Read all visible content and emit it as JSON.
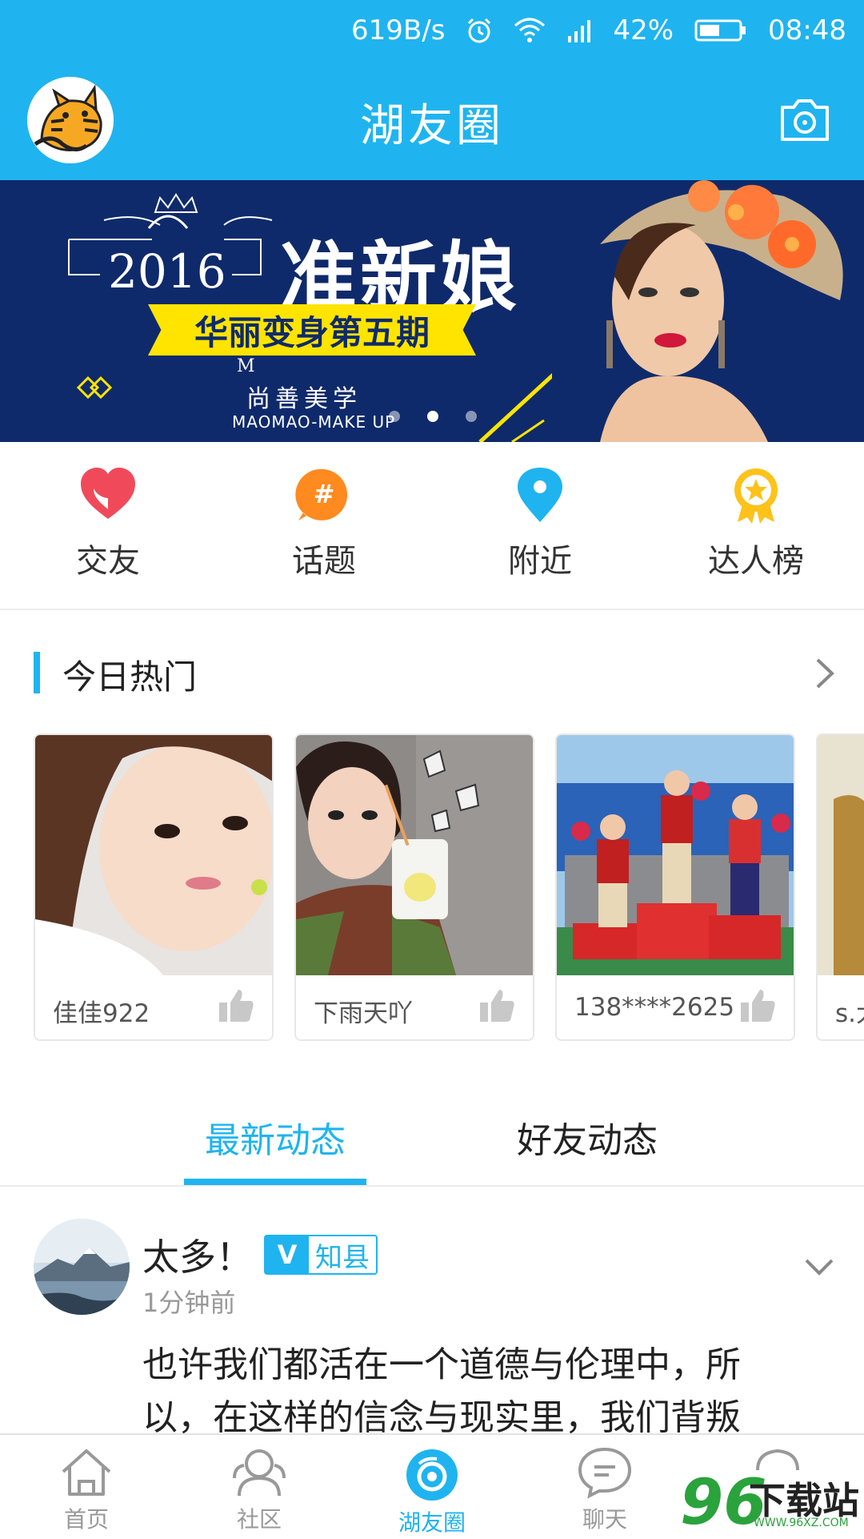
{
  "status_bar": {
    "speed": "619B/s",
    "battery": "42%",
    "time": "08:48",
    "icons": [
      "alarm-icon",
      "wifi-icon",
      "signal-icon",
      "battery-icon"
    ]
  },
  "header": {
    "title": "湖友圈",
    "camera_icon": "camera-icon",
    "accent": "#1fb4ef"
  },
  "banner": {
    "year": "2016",
    "title": "准新娘",
    "ribbon": "华丽变身第五期",
    "brand_letter": "M",
    "brand_cn": "尚善美学",
    "brand_en": "MAOMAO-MAKE UP",
    "dots": 3,
    "active_dot": 2
  },
  "quick_actions": [
    {
      "label": "交友",
      "icon": "heart-icon",
      "color": "#f04a5a"
    },
    {
      "label": "话题",
      "icon": "hashtag-icon",
      "color": "#ff8a1f"
    },
    {
      "label": "附近",
      "icon": "location-pin-icon",
      "color": "#1fb4ef"
    },
    {
      "label": "达人榜",
      "icon": "medal-icon",
      "color": "#ffc21a"
    }
  ],
  "hot": {
    "title": "今日热门",
    "cards": [
      {
        "name": "佳佳922"
      },
      {
        "name": "下雨天吖"
      },
      {
        "name": "138****2625"
      },
      {
        "name": "s.大"
      }
    ]
  },
  "tabs": [
    {
      "label": "最新动态",
      "active": true
    },
    {
      "label": "好友动态",
      "active": false
    }
  ],
  "post": {
    "author": "太多！",
    "badge_v": "V",
    "badge_text": "知县",
    "time": "1分钟前",
    "text": "也许我们都活在一个道德与伦理中，所以，在这样的信念与现实里，我们背叛"
  },
  "bottom_nav": [
    {
      "label": "首页",
      "icon": "home-icon",
      "active": false
    },
    {
      "label": "社区",
      "icon": "community-icon",
      "active": false
    },
    {
      "label": "湖友圈",
      "icon": "circle-icon",
      "active": true
    },
    {
      "label": "聊天",
      "icon": "chat-icon",
      "active": false
    },
    {
      "label": "",
      "icon": "more-icon",
      "active": false
    }
  ],
  "watermark": {
    "num": "96",
    "text": "下载站",
    "url": "WWW.96XZ.COM"
  }
}
